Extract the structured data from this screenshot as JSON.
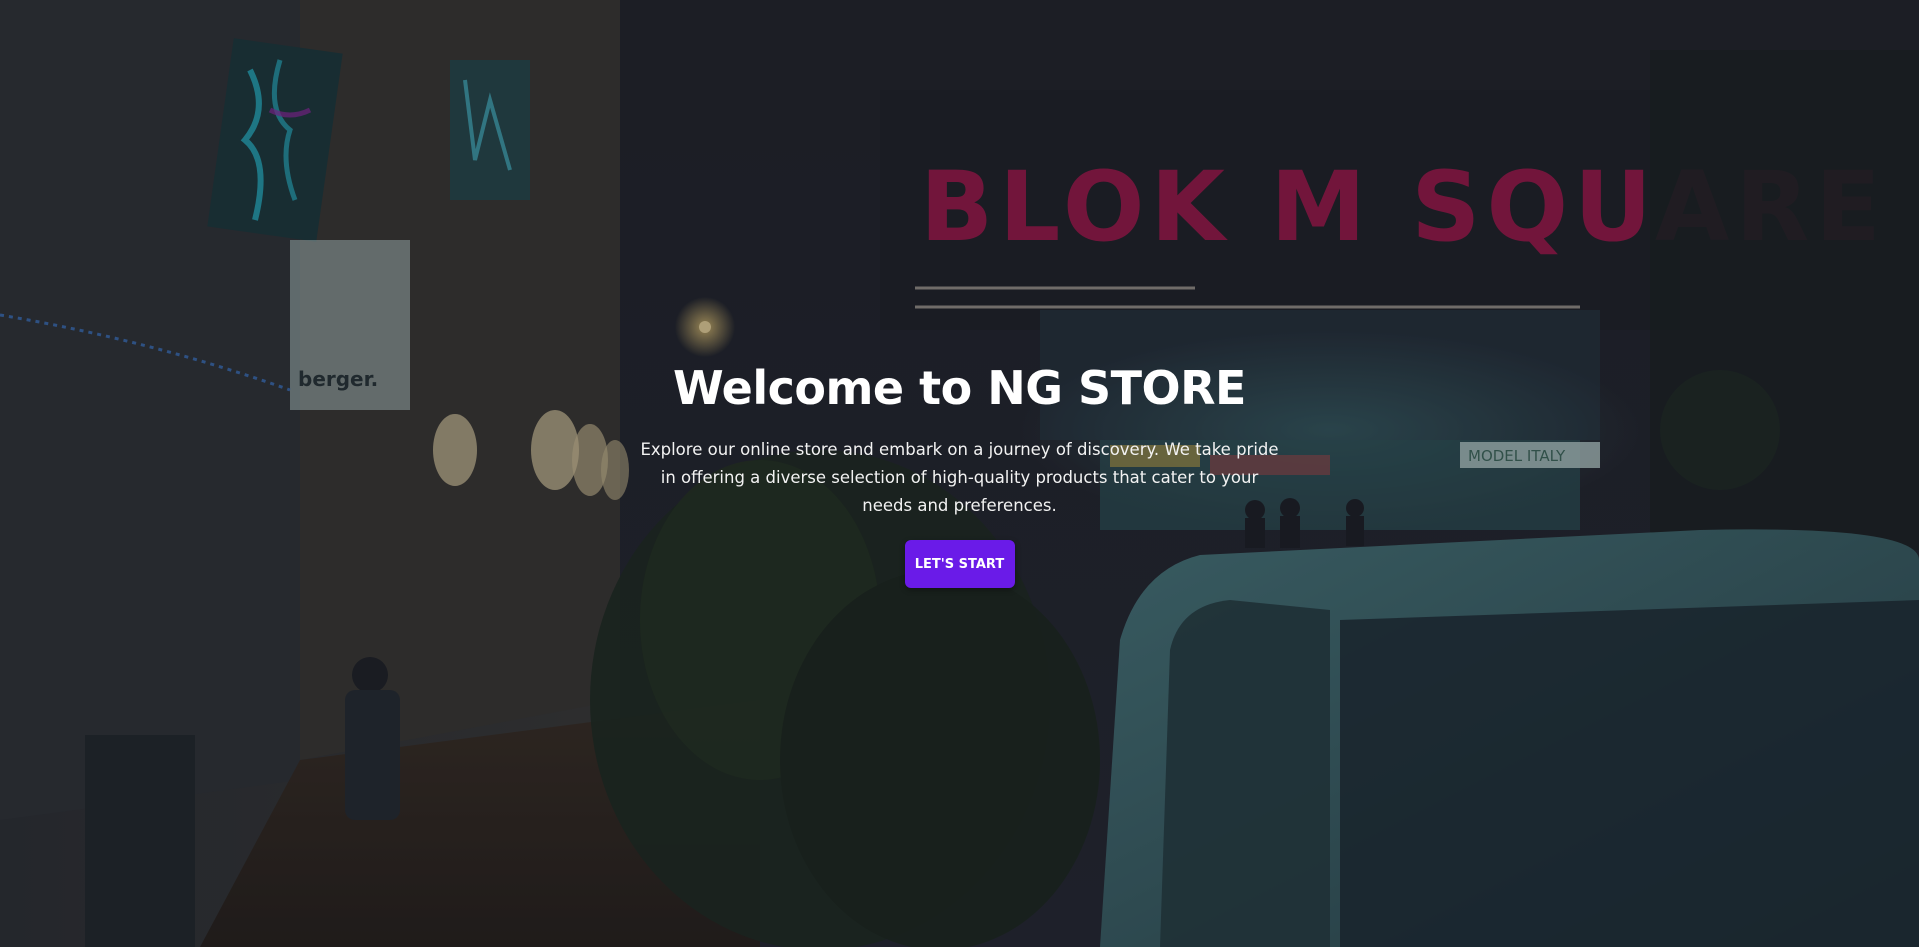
{
  "hero": {
    "title": "Welcome to NG STORE",
    "description": "Explore our online store and embark on a journey of discovery. We take pride in offering a diverse selection of high-quality products that cater to your needs and preferences.",
    "cta_label": "LET'S START"
  },
  "background": {
    "sign_text": "BLOK M SQUARE",
    "storefront_sign": "MODEL ITALY",
    "side_sign": "berger."
  },
  "colors": {
    "accent": "#6a1be8",
    "text": "#ffffff",
    "neon_sign": "#c2185b",
    "neon_teal": "#26c6da"
  }
}
